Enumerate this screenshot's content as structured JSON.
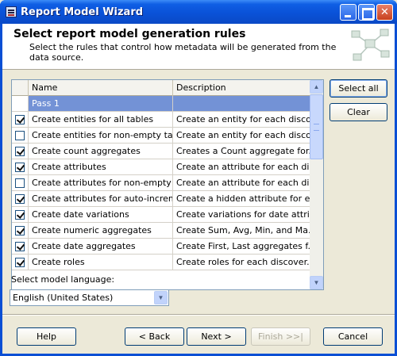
{
  "window": {
    "title": "Report Model Wizard"
  },
  "header": {
    "title": "Select report model generation rules",
    "subtitle": "Select the rules that control how metadata will be generated from the data source."
  },
  "grid": {
    "columns": {
      "name": "Name",
      "description": "Description"
    },
    "rows": [
      {
        "checked": false,
        "name": "Pass 1",
        "description": "",
        "selected": true,
        "group": true
      },
      {
        "checked": true,
        "name": "Create entities for all tables",
        "description": "Create an entity for each disco..."
      },
      {
        "checked": false,
        "name": "Create entities for non-empty tab...",
        "description": "Create an entity for each disco..."
      },
      {
        "checked": true,
        "name": "Create count aggregates",
        "description": "Creates a Count aggregate for..."
      },
      {
        "checked": true,
        "name": "Create attributes",
        "description": "Create an attribute for each di..."
      },
      {
        "checked": false,
        "name": "Create attributes for non-empty ...",
        "description": "Create an attribute for each di..."
      },
      {
        "checked": true,
        "name": "Create attributes for auto-increm...",
        "description": "Create a hidden attribute for e..."
      },
      {
        "checked": true,
        "name": "Create date variations",
        "description": "Create variations for date attri..."
      },
      {
        "checked": true,
        "name": "Create numeric aggregates",
        "description": "Create Sum, Avg, Min, and Ma..."
      },
      {
        "checked": true,
        "name": "Create date aggregates",
        "description": "Create First, Last aggregates f..."
      },
      {
        "checked": true,
        "name": "Create roles",
        "description": "Create roles for each discover..."
      }
    ]
  },
  "side_buttons": {
    "select_all": "Select all",
    "clear": "Clear"
  },
  "language": {
    "label": "Select model language:",
    "value": "English (United States)"
  },
  "footer": {
    "help": "Help",
    "back": "< Back",
    "next": "Next >",
    "finish": "Finish >>|",
    "cancel": "Cancel"
  }
}
